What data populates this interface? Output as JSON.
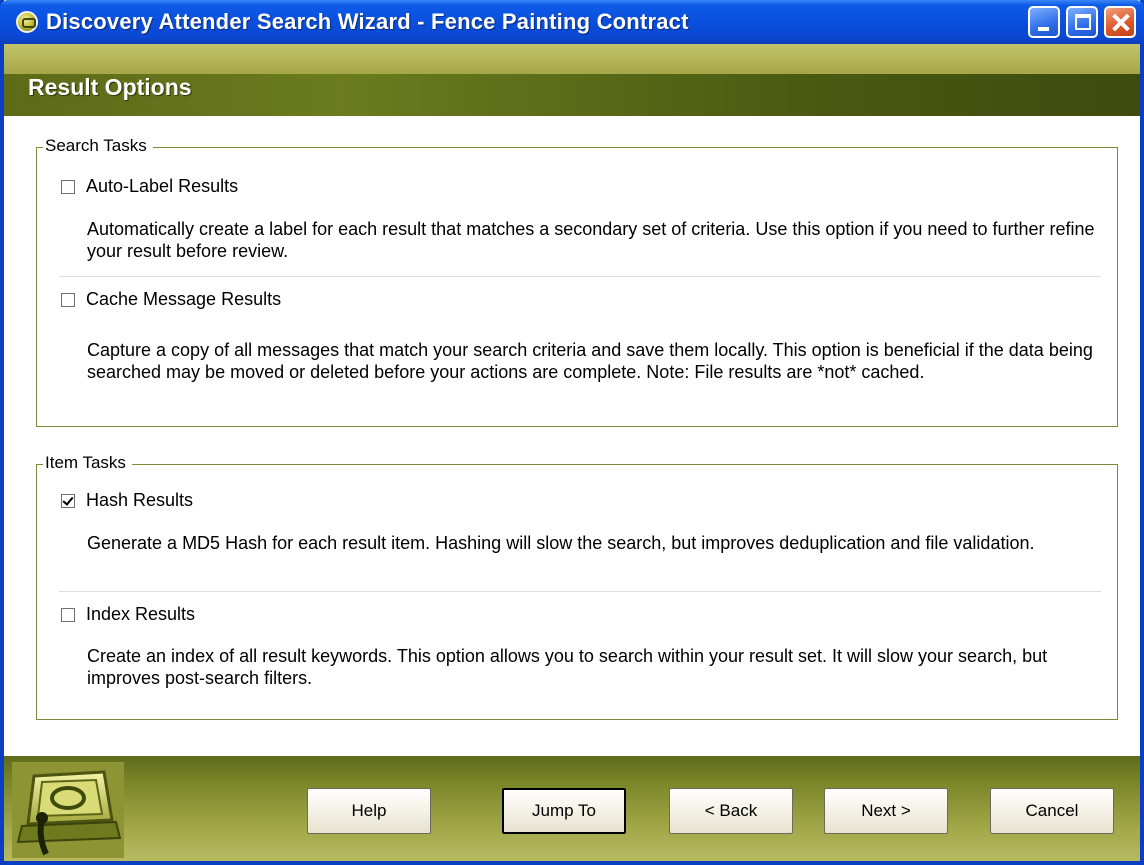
{
  "window": {
    "title": "Discovery Attender Search Wizard - Fence Painting Contract",
    "app_icon": "discovery-attender-icon"
  },
  "header": {
    "title": "Result Options"
  },
  "search_tasks": {
    "legend": "Search Tasks",
    "options": [
      {
        "label": "Auto-Label Results",
        "checked": false,
        "description": "Automatically create a label for each result that matches a secondary set of criteria.  Use this option if you need to further refine your result before review."
      },
      {
        "label": "Cache Message Results",
        "checked": false,
        "description": "Capture a copy of all messages that match your search criteria and save them locally.  This option is beneficial if the data being searched may be moved or deleted before your actions are complete.  Note: File results are *not* cached."
      }
    ]
  },
  "item_tasks": {
    "legend": "Item Tasks",
    "options": [
      {
        "label": "Hash Results",
        "checked": true,
        "description": "Generate a MD5 Hash for each result item.  Hashing will slow the search, but improves deduplication and file validation."
      },
      {
        "label": "Index Results",
        "checked": false,
        "description": "Create an index of all result keywords.  This option allows you to search within your result set. It will slow your search, but improves post-search filters."
      }
    ]
  },
  "footer": {
    "buttons": {
      "help": "Help",
      "jump_to": "Jump To",
      "back": "< Back",
      "next": "Next >",
      "cancel": "Cancel"
    }
  },
  "colors": {
    "titlebar": "#0a4fdc",
    "header_band": "#6b7b1e",
    "group_border": "#7d8b3b"
  }
}
